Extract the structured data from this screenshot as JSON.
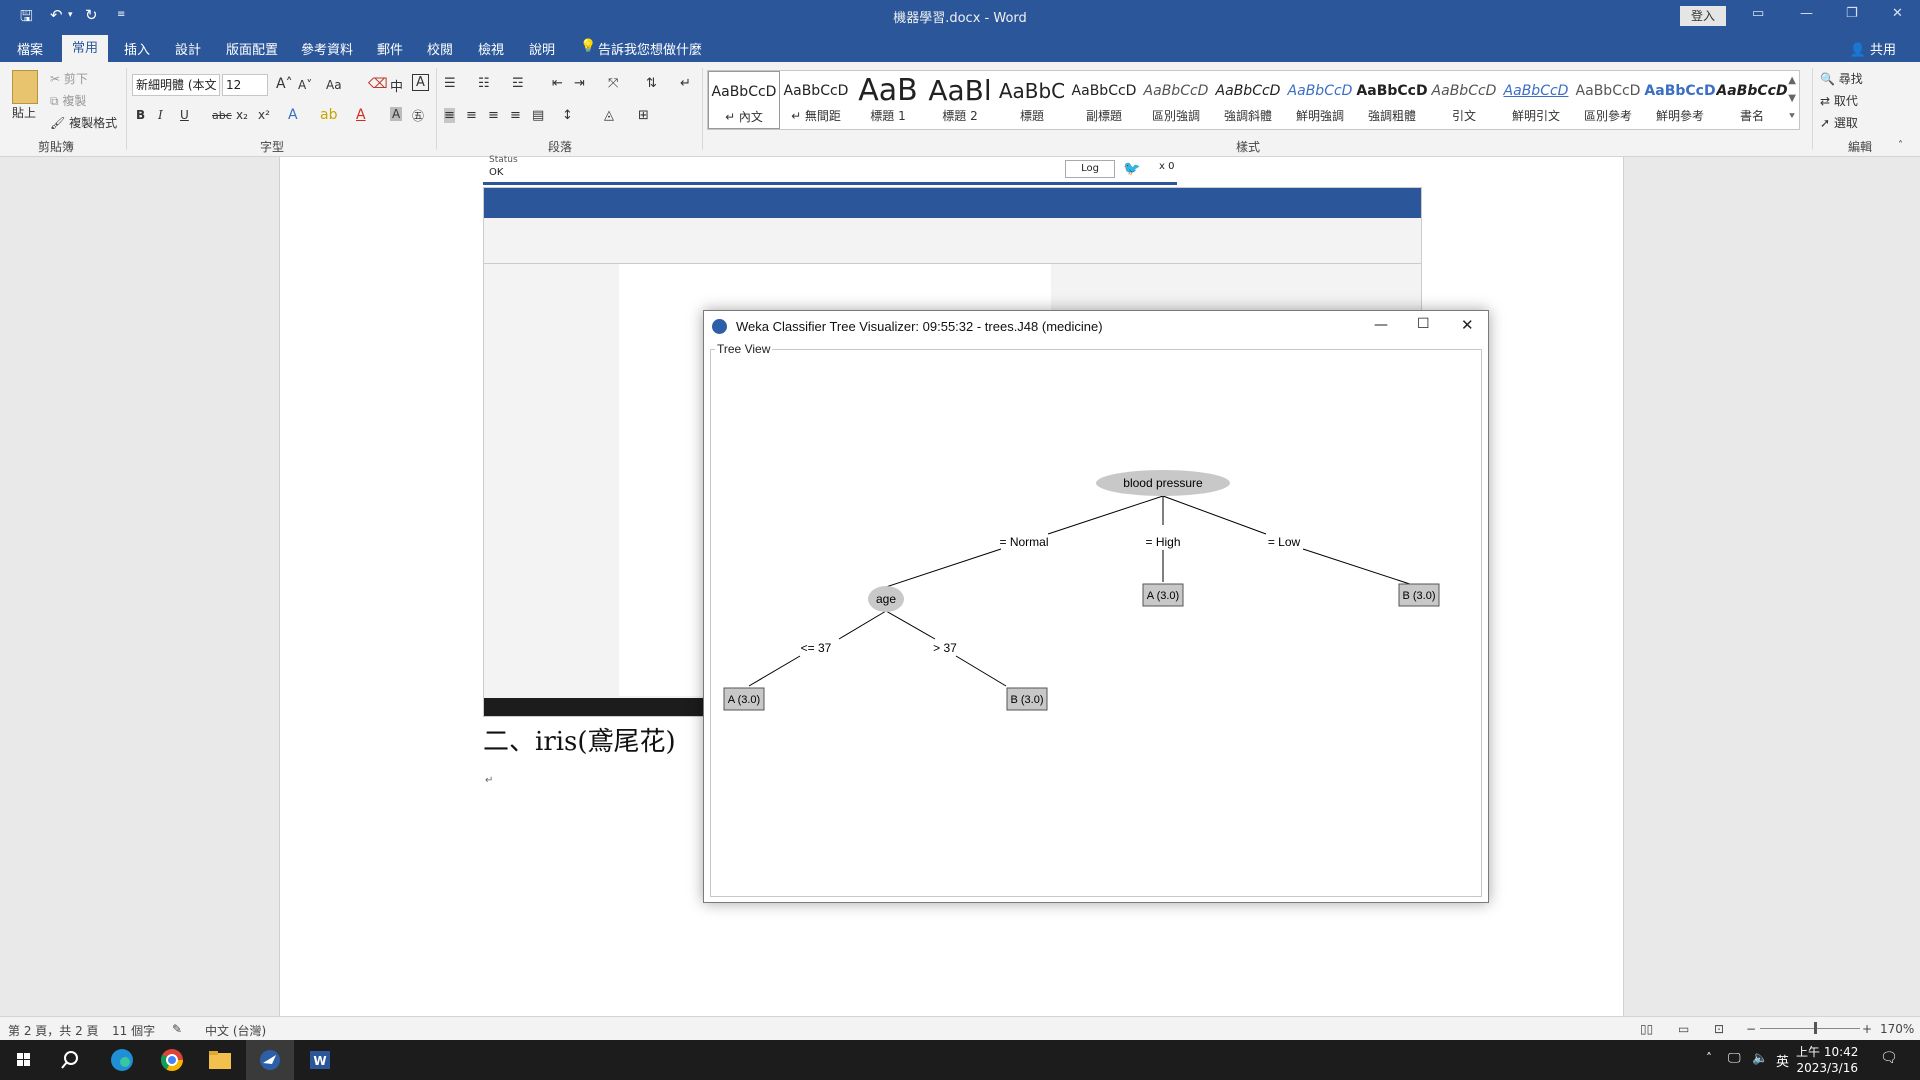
{
  "window": {
    "title": "機器學習.docx - Word",
    "sign_in": "登入",
    "share": "共用"
  },
  "tabs": [
    "檔案",
    "常用",
    "插入",
    "設計",
    "版面配置",
    "參考資料",
    "郵件",
    "校閱",
    "檢視",
    "說明"
  ],
  "tell_me": "告訴我您想做什麼",
  "ribbon": {
    "clipboard": {
      "paste": "貼上",
      "cut": "剪下",
      "copy": "複製",
      "format_painter": "複製格式",
      "label": "剪貼簿"
    },
    "font": {
      "name": "新細明體 (本文",
      "size": "12",
      "label": "字型",
      "aa": "Aa"
    },
    "paragraph": {
      "label": "段落"
    },
    "styles": {
      "label": "樣式",
      "items": [
        {
          "preview": "AaBbCcD",
          "name": "↵ 內文"
        },
        {
          "preview": "AaBbCcD",
          "name": "↵ 無間距"
        },
        {
          "preview": "AaB",
          "name": "標題 1"
        },
        {
          "preview": "AaBl",
          "name": "標題 2"
        },
        {
          "preview": "AaBbC",
          "name": "標題"
        },
        {
          "preview": "AaBbCcD",
          "name": "副標題"
        },
        {
          "preview": "AaBbCcD",
          "name": "區別強調"
        },
        {
          "preview": "AaBbCcD",
          "name": "強調斜體"
        },
        {
          "preview": "AaBbCcD",
          "name": "鮮明強調"
        },
        {
          "preview": "AaBbCcD",
          "name": "強調粗體"
        },
        {
          "preview": "AaBbCcD",
          "name": "引文"
        },
        {
          "preview": "AaBbCcD",
          "name": "鮮明引文"
        },
        {
          "preview": "AaBbCcD",
          "name": "區別參考"
        },
        {
          "preview": "AaBbCcD",
          "name": "鮮明參考"
        },
        {
          "preview": "AaBbCcD",
          "name": "書名"
        }
      ]
    },
    "editing": {
      "find": "尋找",
      "replace": "取代",
      "select": "選取",
      "label": "編輯"
    }
  },
  "document": {
    "embedded_top": {
      "status_label": "Status",
      "status_value": "OK",
      "log_button": "Log",
      "x_count": "x 0"
    },
    "heading": "二、iris(鳶尾花)"
  },
  "weka": {
    "title": "Weka Classifier Tree Visualizer: 09:55:32 - trees.J48 (medicine)",
    "panel_label": "Tree View",
    "tree": {
      "root": "blood pressure",
      "edges": [
        "= Normal",
        "= High",
        "= Low",
        "<= 37",
        "> 37"
      ],
      "inner_node": "age",
      "leaves": [
        "A (3.0)",
        "B (3.0)",
        "A (3.0)",
        "B (3.0)"
      ]
    }
  },
  "statusbar": {
    "page": "第 2 頁，共 2 頁",
    "words": "11 個字",
    "language": "中文 (台灣)",
    "zoom": "170%"
  },
  "taskbar": {
    "ime": "英",
    "time": "上午 10:42",
    "date": "2023/3/16"
  },
  "colors": {
    "word_blue": "#2b579a",
    "node_gray": "#c8c8c8"
  }
}
